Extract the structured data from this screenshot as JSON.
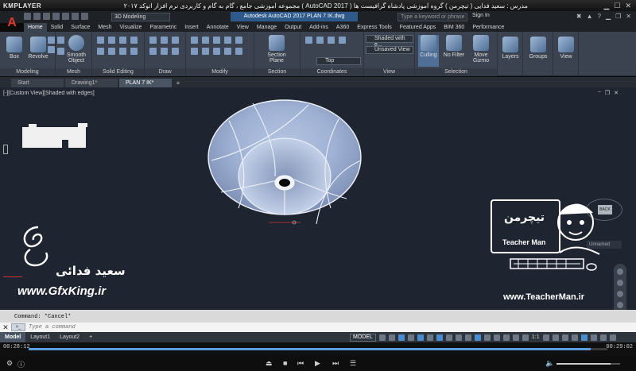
{
  "player": {
    "logo": "KMPLAYER",
    "title": "مجموعه آموزشی جامع ، گام به گام و کاربردی نرم افزار  اتوکد ۲۰۱۷ ( AutoCAD 2017 )  مدرس : سعید فدایی ( تیچرمن ) گروه آموزشی پادشاه گرافیست ها",
    "time_elapsed": "00:28:12",
    "time_total": "00:29:02",
    "progress": 0.971,
    "volume": 0.85
  },
  "acad": {
    "app_letter": "A",
    "workspace": "3D Modeling",
    "window_title": "Autodesk AutoCAD 2017    PLAN 7 IK.dwg",
    "search_placeholder": "Type a keyword or phrase",
    "signin": "Sign In"
  },
  "ribbon": {
    "tabs": [
      {
        "label": "Home",
        "active": true
      },
      {
        "label": "Solid"
      },
      {
        "label": "Surface"
      },
      {
        "label": "Mesh"
      },
      {
        "label": "Visualize"
      },
      {
        "label": "Parametric"
      },
      {
        "label": "Insert"
      },
      {
        "label": "Annotate"
      },
      {
        "label": "View"
      },
      {
        "label": "Manage"
      },
      {
        "label": "Output"
      },
      {
        "label": "Add-ins"
      },
      {
        "label": "A360"
      },
      {
        "label": "Express Tools"
      },
      {
        "label": "Featured Apps"
      },
      {
        "label": "BIM 360"
      },
      {
        "label": "Performance"
      }
    ],
    "panels": {
      "modeling": "Modeling",
      "mesh": "Mesh",
      "solid_editing": "Solid Editing",
      "draw": "Draw",
      "modify": "Modify",
      "section": "Section",
      "coordinates": "Coordinates",
      "view": "View",
      "selection": "Selection"
    },
    "tools": {
      "box": "Box",
      "revolve": "Revolve",
      "smooth_object_1": "Smooth",
      "smooth_object_2": "Object",
      "section_plane_1": "Section",
      "section_plane_2": "Plane",
      "culling": "Culling",
      "no_filter": "No Filter",
      "move_gizmo_1": "Move",
      "move_gizmo_2": "Gizmo",
      "layers": "Layers",
      "groups": "Groups",
      "view": "View"
    },
    "visual_style": "Shaded with e...",
    "saved_view": "Unsaved View",
    "ucs_view": "Top"
  },
  "file_tabs": [
    {
      "label": "Start"
    },
    {
      "label": "Drawing1*"
    },
    {
      "label": "PLAN 7 IK*",
      "active": true
    }
  ],
  "viewport": {
    "label": "[-][Custom View][Shaded with edges]",
    "viewcube": "BACK",
    "ucs_name": "Unnamed"
  },
  "watermarks": {
    "author": "سعید فدائی",
    "site_left": "www.GfxKing.ir",
    "site_right": "www.TeacherMan.ir",
    "brand_en": "Teacher Man"
  },
  "command": {
    "history": "Command: *Cancel*",
    "placeholder": "Type a command"
  },
  "layout_tabs": [
    {
      "label": "Model",
      "active": true
    },
    {
      "label": "Layout1"
    },
    {
      "label": "Layout2"
    }
  ],
  "status": {
    "model": "MODEL",
    "scale": "1:1"
  }
}
